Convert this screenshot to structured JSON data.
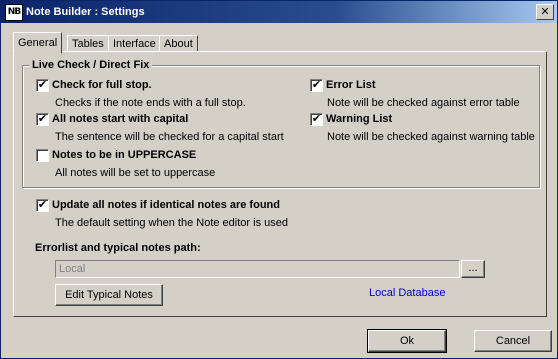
{
  "window": {
    "title": "Note Builder : Settings",
    "icon_text": "NB",
    "close_glyph": "✕"
  },
  "tabs": [
    {
      "label": "General",
      "active": true
    },
    {
      "label": "Tables",
      "active": false
    },
    {
      "label": "Interface",
      "active": false
    },
    {
      "label": "About",
      "active": false
    }
  ],
  "live_check": {
    "legend": "Live Check / Direct Fix",
    "options": [
      {
        "label": "Check for full stop.",
        "checked": true,
        "description": "Checks if the note ends with a full stop."
      },
      {
        "label": "All notes start with capital",
        "checked": true,
        "description": "The sentence will be checked for a capital start"
      },
      {
        "label": "Notes to be in UPPERCASE",
        "checked": false,
        "description": "All notes will be set to uppercase"
      },
      {
        "label": "Error List",
        "checked": true,
        "description": "Note will be checked against error table"
      },
      {
        "label": "Warning List",
        "checked": true,
        "description": "Note will be checked against warning table"
      }
    ]
  },
  "update_identical": {
    "label": "Update all notes if identical notes are found",
    "checked": true,
    "description": "The default setting when the Note editor is used"
  },
  "path_section": {
    "label": "Errorlist and typical notes path:",
    "value": "Local",
    "browse_label": "...",
    "edit_button_label": "Edit Typical Notes",
    "link_label": "Local Database"
  },
  "footer": {
    "ok_label": "Ok",
    "cancel_label": "Cancel"
  },
  "check_glyph": "✔"
}
